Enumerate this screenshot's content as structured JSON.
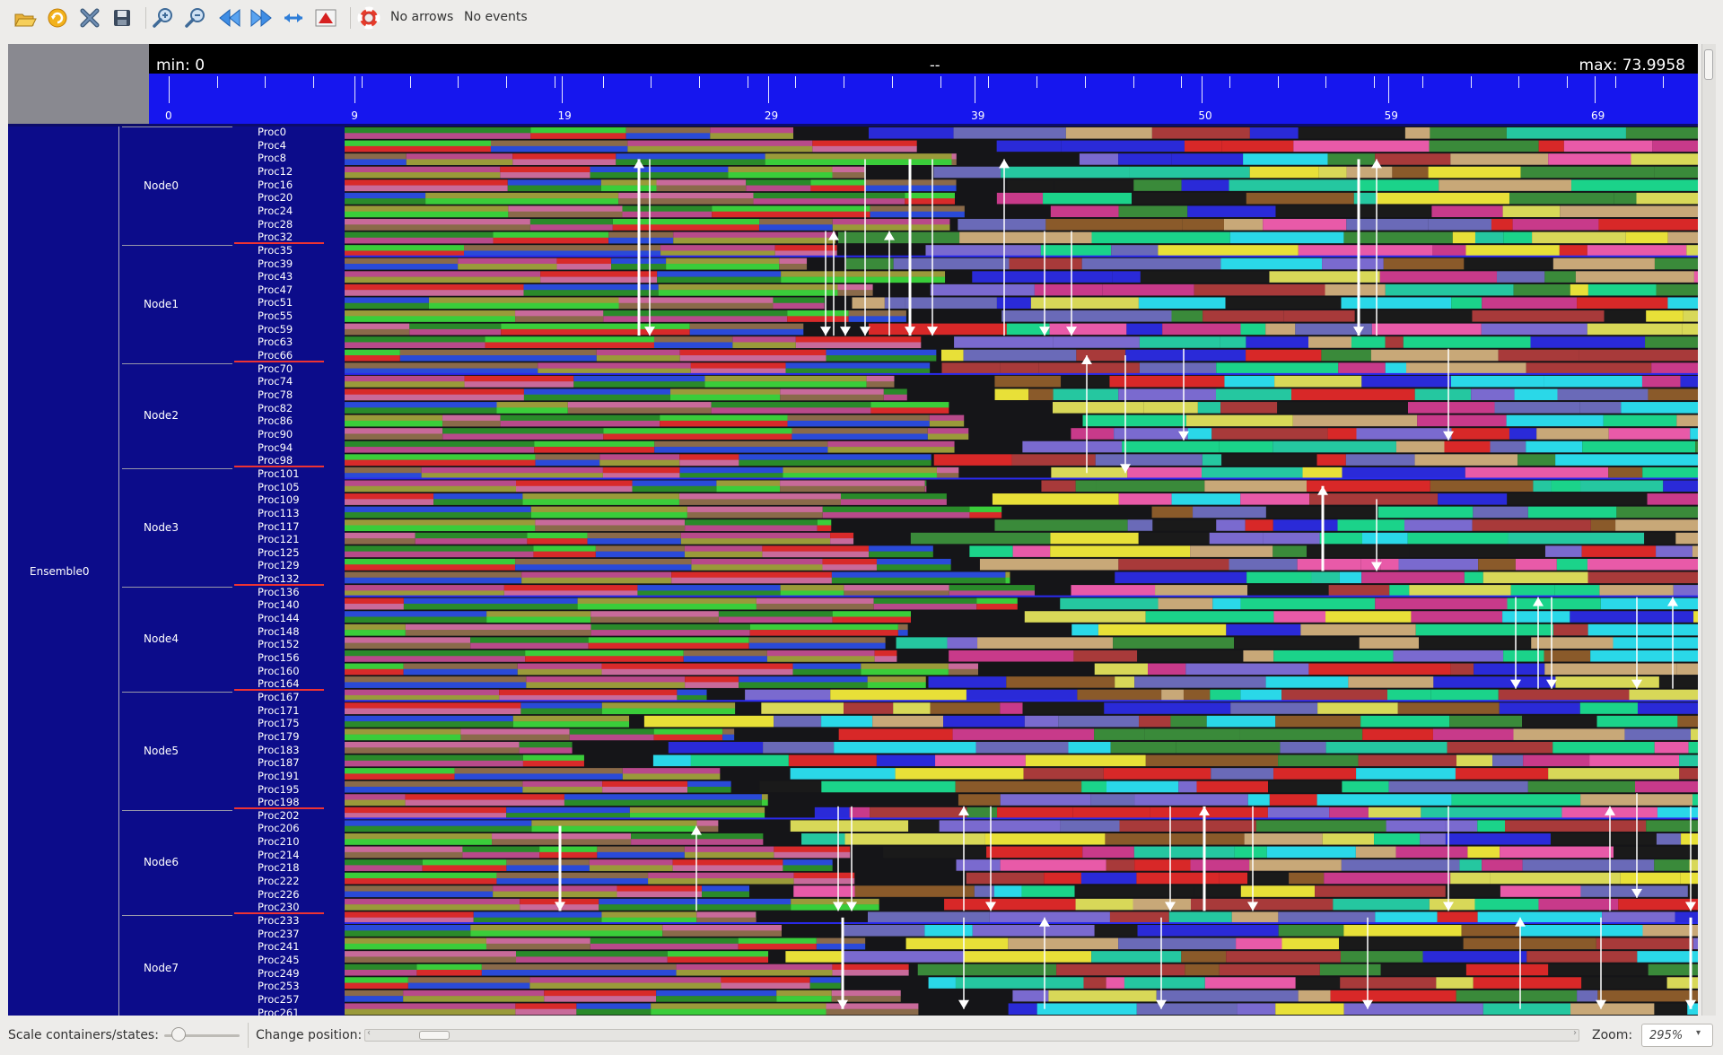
{
  "toolbar": {
    "buttons": [
      "open",
      "reload",
      "close",
      "export",
      "zoom-in",
      "zoom-out",
      "previous",
      "next",
      "fit",
      "show-all",
      "help"
    ],
    "arrows_label": "No arrows",
    "events_label": "No events"
  },
  "ruler": {
    "min_label": "min: 0",
    "center_label": "--",
    "max_label": "max: 73.9958",
    "min": 0,
    "max": 73.9958,
    "ticks": [
      "0",
      "9",
      "19",
      "29",
      "39",
      "50",
      "59",
      "69"
    ],
    "tick_values": [
      0,
      9,
      19,
      29,
      39,
      50,
      59,
      69
    ]
  },
  "tree": {
    "ensemble": "Ensemble0",
    "nodes": [
      {
        "name": "Node0",
        "procs": [
          "Proc0",
          "Proc4",
          "Proc8",
          "Proc12",
          "Proc16",
          "Proc20",
          "Proc24",
          "Proc28",
          "Proc32"
        ]
      },
      {
        "name": "Node1",
        "procs": [
          "Proc35",
          "Proc39",
          "Proc43",
          "Proc47",
          "Proc51",
          "Proc55",
          "Proc59",
          "Proc63",
          "Proc66"
        ]
      },
      {
        "name": "Node2",
        "procs": [
          "Proc70",
          "Proc74",
          "Proc78",
          "Proc82",
          "Proc86",
          "Proc90",
          "Proc94",
          "Proc98"
        ]
      },
      {
        "name": "Node3",
        "procs": [
          "Proc101",
          "Proc105",
          "Proc109",
          "Proc113",
          "Proc117",
          "Proc121",
          "Proc125",
          "Proc129",
          "Proc132"
        ]
      },
      {
        "name": "Node4",
        "procs": [
          "Proc136",
          "Proc140",
          "Proc144",
          "Proc148",
          "Proc152",
          "Proc156",
          "Proc160",
          "Proc164"
        ]
      },
      {
        "name": "Node5",
        "procs": [
          "Proc167",
          "Proc171",
          "Proc175",
          "Proc179",
          "Proc183",
          "Proc187",
          "Proc191",
          "Proc195",
          "Proc198"
        ]
      },
      {
        "name": "Node6",
        "procs": [
          "Proc202",
          "Proc206",
          "Proc210",
          "Proc214",
          "Proc218",
          "Proc222",
          "Proc226",
          "Proc230"
        ]
      },
      {
        "name": "Node7",
        "procs": [
          "Proc233",
          "Proc237",
          "Proc241",
          "Proc245",
          "Proc249",
          "Proc253",
          "Proc257",
          "Proc261"
        ]
      }
    ]
  },
  "statusbar": {
    "scale_label": "Scale containers/states:",
    "position_label": "Change position:",
    "zoom_label": "Zoom:",
    "zoom_value": "295%"
  },
  "colors": {
    "ruler_blue": "#1616ee",
    "tree_bg": "#0c0c8a",
    "proc_marker": "#e33333",
    "arrow": "#ffffff"
  }
}
